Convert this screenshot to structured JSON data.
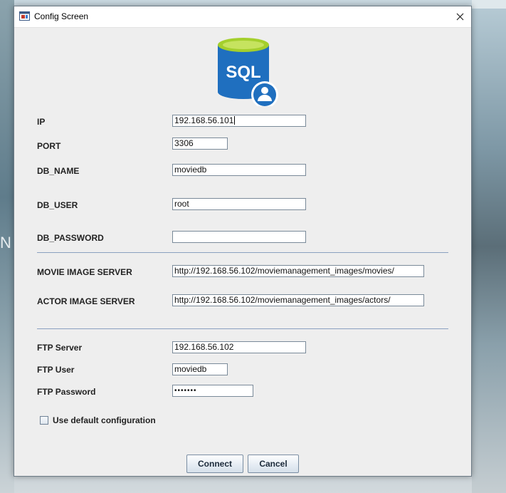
{
  "window": {
    "title": "Config Screen",
    "close_icon": "close-icon",
    "app_icon": "java-app-icon"
  },
  "logo": {
    "text": "SQL",
    "icon": "sql-database-user-icon",
    "colors": {
      "cylinder": "#1f6fbf",
      "top": "#a4cf2c",
      "badge": "#1f6fbf"
    }
  },
  "background": {
    "partial_letter": "N"
  },
  "form": {
    "ip": {
      "label": "IP",
      "value": "192.168.56.101"
    },
    "port": {
      "label": "PORT",
      "value": "3306"
    },
    "db_name": {
      "label": "DB_NAME",
      "value": "moviedb"
    },
    "db_user": {
      "label": "DB_USER",
      "value": "root"
    },
    "db_password": {
      "label": "DB_PASSWORD",
      "value": ""
    },
    "movie_image_server": {
      "label": "MOVIE IMAGE SERVER",
      "value": "http://192.168.56.102/moviemanagement_images/movies/"
    },
    "actor_image_server": {
      "label": "ACTOR IMAGE SERVER",
      "value": "http://192.168.56.102/moviemanagement_images/actors/"
    },
    "ftp_server": {
      "label": "FTP Server",
      "value": "192.168.56.102"
    },
    "ftp_user": {
      "label": "FTP User",
      "value": "moviedb"
    },
    "ftp_password": {
      "label": "FTP Password",
      "value": "•••••••"
    },
    "use_default": {
      "label": "Use default configuration",
      "checked": false
    }
  },
  "buttons": {
    "connect": "Connect",
    "cancel": "Cancel"
  }
}
